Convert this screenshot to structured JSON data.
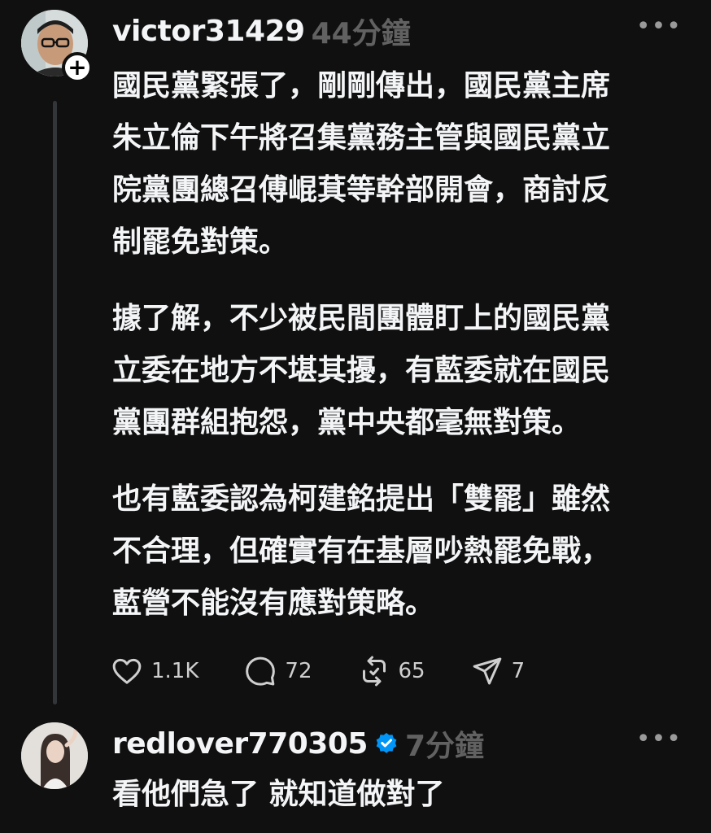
{
  "posts": [
    {
      "username": "victor31429",
      "time": "44分鐘",
      "follow_icon": "plus",
      "more_icon": "•••",
      "paragraphs": [
        "國民黨緊張了，剛剛傳出，國民黨主席\n朱立倫下午將召集黨務主管與國民黨立\n院黨團總召傅崐萁等幹部開會，商討反\n制罷免對策。",
        "據了解，不少被民間團體盯上的國民黨\n立委在地方不堪其擾，有藍委就在國民\n黨團群組抱怨，黨中央都毫無對策。",
        "也有藍委認為柯建銘提出「雙罷」雖然\n不合理，但確實有在基層吵熱罷免戰，\n藍營不能沒有應對策略。"
      ],
      "actions": {
        "like": "1.1K",
        "comment": "72",
        "repost": "65",
        "share": "7"
      }
    },
    {
      "username": "redlover770305",
      "verified": true,
      "time": "7分鐘",
      "more_icon": "•••",
      "text": "看他們急了 就知道做對了"
    }
  ],
  "colors": {
    "background": "#101010",
    "text": "#f3f5f7",
    "muted": "#616161",
    "verified": "#0095f6",
    "thread_line": "#333638"
  }
}
